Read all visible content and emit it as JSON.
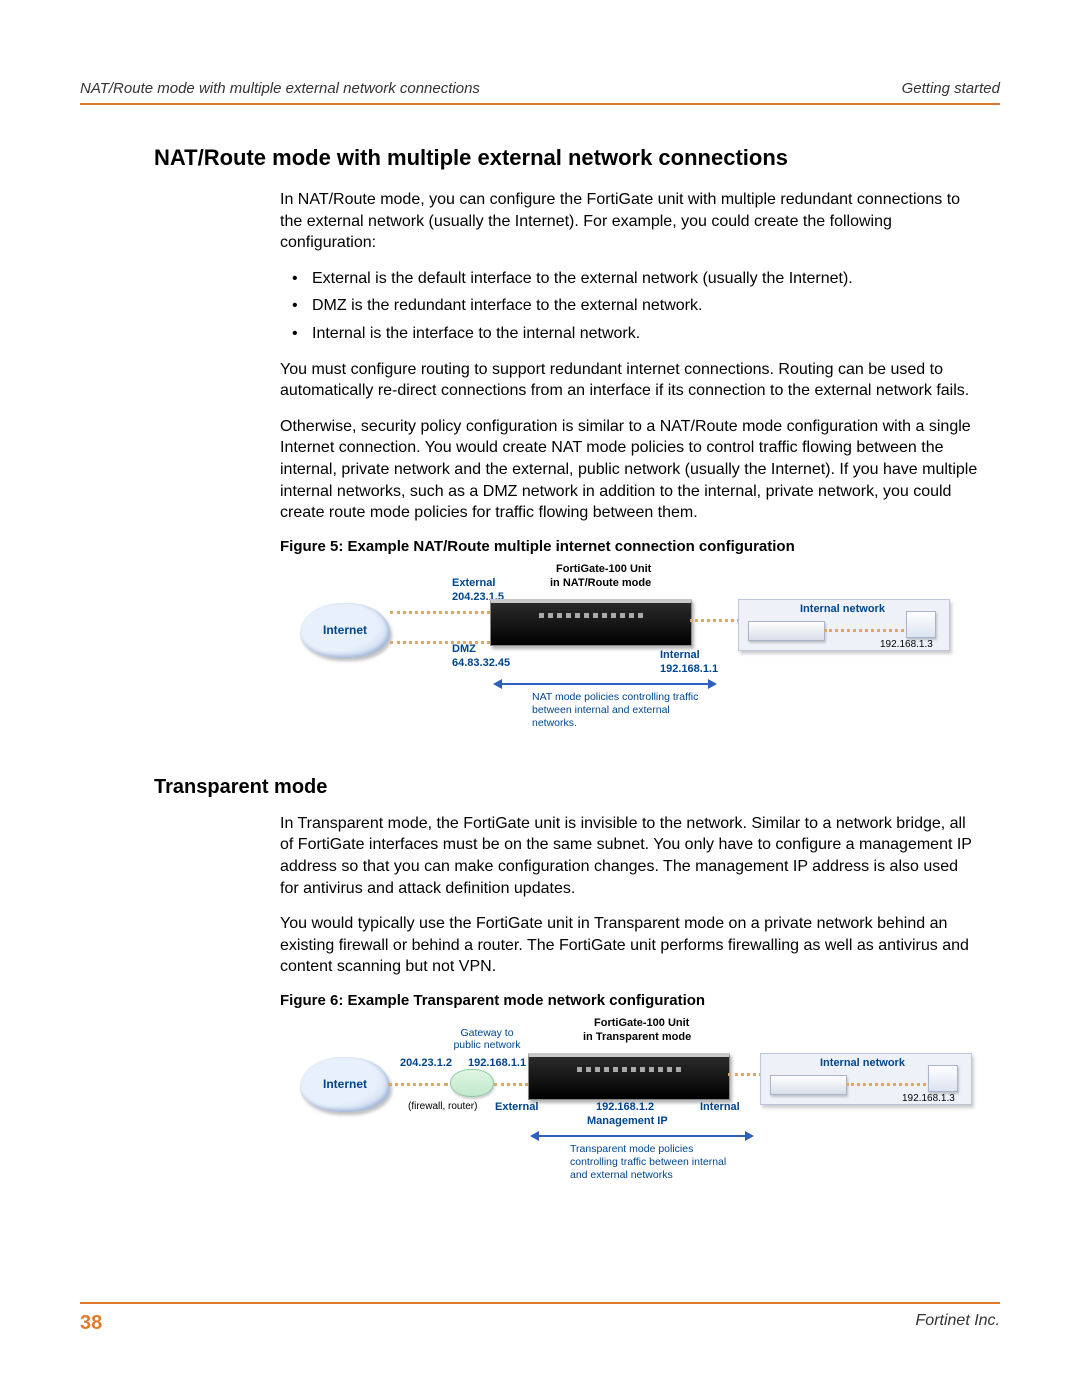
{
  "header": {
    "left": "NAT/Route mode with multiple external network connections",
    "right": "Getting started"
  },
  "section1": {
    "title": "NAT/Route mode with multiple external network connections",
    "p1": "In NAT/Route mode, you can configure the FortiGate unit with multiple redundant connections to the external network (usually the Internet). For example, you could create the following configuration:",
    "bullets": [
      "External is the default interface to the external network (usually the Internet).",
      "DMZ is the redundant interface to the external network.",
      "Internal is the interface to the internal network."
    ],
    "p2": "You must configure routing to support redundant internet connections. Routing can be used to automatically re-direct connections from an interface if its connection to the external network fails.",
    "p3": "Otherwise, security policy configuration is similar to a NAT/Route mode configuration with a single Internet connection. You would create NAT mode policies to control traffic flowing between the internal, private network and the external, public network (usually the Internet). If you have multiple internal networks, such as a DMZ network in addition to the internal, private network, you could create route mode policies for traffic flowing between them.",
    "fig_caption": "Figure 5:  Example NAT/Route multiple internet connection configuration"
  },
  "fig5": {
    "unit_title": "FortiGate-100 Unit",
    "unit_mode": "in NAT/Route mode",
    "external_label": "External",
    "external_ip": "204.23.1.5",
    "dmz_label": "DMZ",
    "dmz_ip": "64.83.32.45",
    "internet": "Internet",
    "internal_label": "Internal",
    "internal_ip": "192.168.1.1",
    "internal_net": "Internal network",
    "host_ip": "192.168.1.3",
    "policy_note": "NAT mode policies controlling traffic between internal and external networks."
  },
  "section2": {
    "title": "Transparent mode",
    "p1": "In Transparent mode, the FortiGate unit is invisible to the network. Similar to a network bridge, all of FortiGate interfaces must be on the same subnet. You only have to configure a management IP address so that you can make configuration changes. The management IP address is also used for antivirus and attack definition updates.",
    "p2": "You would typically use the FortiGate unit in Transparent mode on a private network behind an existing firewall or behind a router. The FortiGate unit performs firewalling as well as antivirus and content scanning but not VPN.",
    "fig_caption": "Figure 6:  Example Transparent mode network configuration"
  },
  "fig6": {
    "unit_title": "FortiGate-100 Unit",
    "unit_mode": "in Transparent mode",
    "gateway_label": "Gateway to public network",
    "ext_ip": "204.23.1.2",
    "gw_ip": "192.168.1.1",
    "internet": "Internet",
    "fw_router": "(firewall, router)",
    "external_label": "External",
    "mgmt_ip": "192.168.1.2",
    "mgmt_label": "Management IP",
    "internal_label": "Internal",
    "internal_net": "Internal network",
    "host_ip": "192.168.1.3",
    "policy_note": "Transparent mode policies controlling traffic between internal and external networks"
  },
  "footer": {
    "page": "38",
    "company": "Fortinet Inc."
  }
}
